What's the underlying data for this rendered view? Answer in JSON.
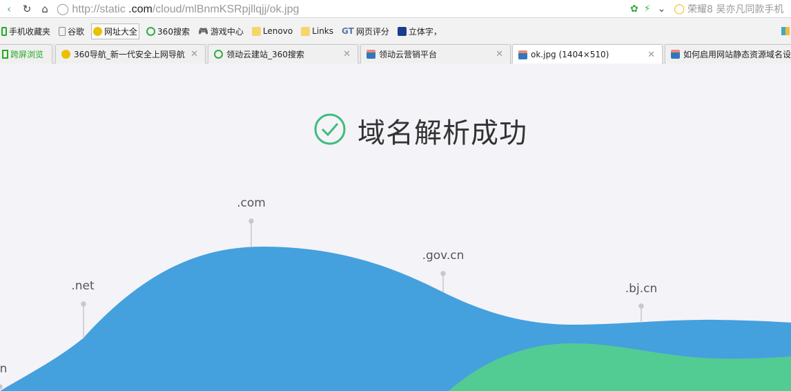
{
  "browser": {
    "url_prefix": "http://static",
    "url_domain": "  .com",
    "url_path": "/cloud/mlBnmKSRpjllqjj/ok.jpg",
    "search_text": "荣耀8 吴亦凡同款手机",
    "bookmarks": [
      "手机收藏夹",
      "谷歌",
      "网址大全",
      "360搜索",
      "游戏中心",
      "Lenovo",
      "Links",
      "网页评分",
      "立体字，"
    ],
    "tabs": [
      {
        "label": "跨屏浏览"
      },
      {
        "label": "360导航_新一代安全上网导航"
      },
      {
        "label": "领动云建站_360搜索"
      },
      {
        "label": "领动云营销平台"
      },
      {
        "label": "ok.jpg (1404×510)",
        "active": true
      },
      {
        "label": "如何启用网站静态资源域名设"
      }
    ]
  },
  "page": {
    "title": "域名解析成功",
    "labels": [
      ".com",
      ".net",
      ".gov.cn",
      ".bj.cn",
      "n"
    ],
    "colors": {
      "wave_blue": "#45a0de",
      "wave_green": "#52cc92",
      "check": "#3dbd7d"
    }
  }
}
